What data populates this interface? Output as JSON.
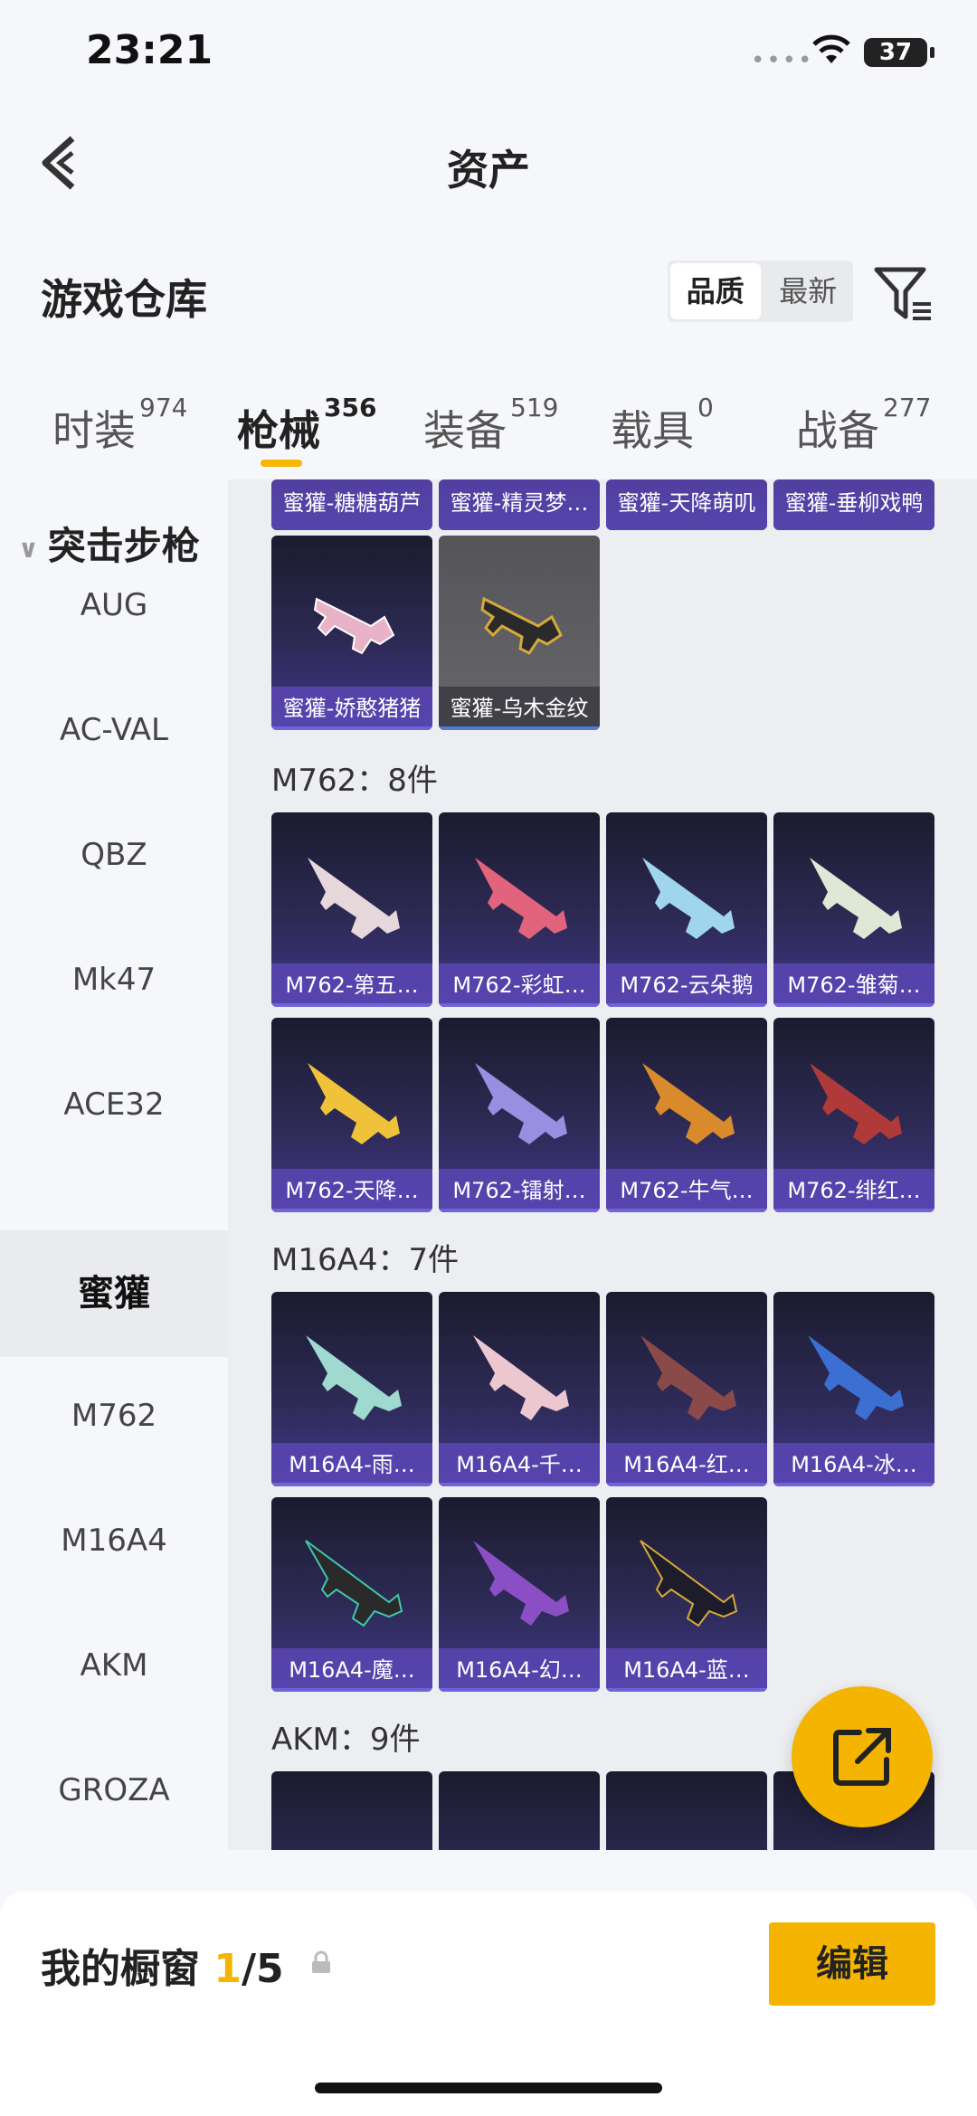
{
  "status": {
    "time": "23:21",
    "battery": "37"
  },
  "header": {
    "title": "资产"
  },
  "warehouse": {
    "title": "游戏仓库",
    "sort_options": [
      "品质",
      "最新"
    ]
  },
  "tabs": [
    {
      "label": "时装",
      "count": "974"
    },
    {
      "label": "枪械",
      "count": "356"
    },
    {
      "label": "装备",
      "count": "519"
    },
    {
      "label": "载具",
      "count": "0"
    },
    {
      "label": "战备",
      "count": "277"
    }
  ],
  "sidebar": {
    "category": "突击步枪",
    "items": [
      "AUG",
      "AC-VAL",
      "QBZ",
      "Mk47",
      "ACE32",
      "蜜獾",
      "M762",
      "M16A4",
      "AKM",
      "GROZA"
    ],
    "active_item": "蜜獾"
  },
  "sections": {
    "honey_badger_top": [
      "蜜獾-糖糖葫芦",
      "蜜獾-精灵梦…",
      "蜜獾-天降萌叽",
      "蜜獾-垂柳戏鸭"
    ],
    "honey_badger_more": [
      "蜜獾-娇憨猪猪",
      "蜜獾-乌木金纹"
    ],
    "m762": {
      "title": "M762：8件",
      "items": [
        "M762-第五…",
        "M762-彩虹…",
        "M762-云朵鹅",
        "M762-雏菊…",
        "M762-天降…",
        "M762-镭射…",
        "M762-牛气…",
        "M762-绯红…"
      ]
    },
    "m16a4": {
      "title": "M16A4：7件",
      "items": [
        "M16A4-雨…",
        "M16A4-千…",
        "M16A4-红…",
        "M16A4-冰…",
        "M16A4-魔…",
        "M16A4-幻…",
        "M16A4-蓝…"
      ]
    },
    "akm": {
      "title": "AKM：9件"
    }
  },
  "bottom": {
    "label": "我的橱窗",
    "current": "1",
    "total": "/5",
    "edit_label": "编辑"
  },
  "colors": {
    "accent": "#f5b400",
    "card_purple": "#3f378a"
  }
}
